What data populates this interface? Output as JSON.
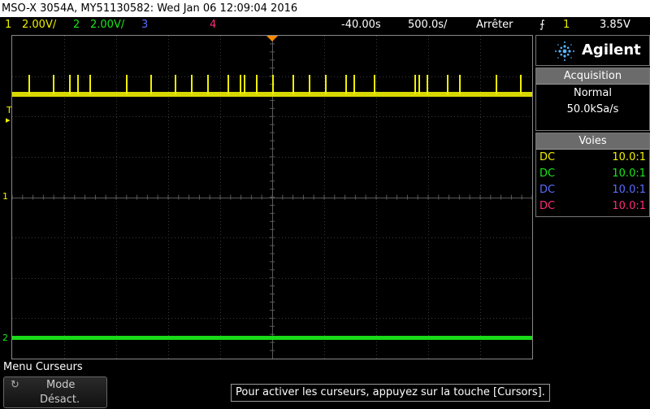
{
  "title": "MSO-X 3054A, MY51130582: Wed Jan 06 12:09:04 2016",
  "status": {
    "ch1_num": "1",
    "ch1_scale": "2.00V/",
    "ch2_num": "2",
    "ch2_scale": "2.00V/",
    "ch3_num": "3",
    "ch4_num": "4",
    "time_offset": "-40.00s",
    "time_scale": "500.0s/",
    "run_state": "Arrêter",
    "trigger_source": "1",
    "trigger_level": "3.85V"
  },
  "markers": {
    "trigger": "T",
    "ch1": "1",
    "ch2": "2"
  },
  "brand": "Agilent",
  "acquisition": {
    "header": "Acquisition",
    "mode": "Normal",
    "rate": "50.0kSa/s"
  },
  "voies": {
    "header": "Voies",
    "rows": [
      {
        "coupling": "DC",
        "probe": "10.0:1"
      },
      {
        "coupling": "DC",
        "probe": "10.0:1"
      },
      {
        "coupling": "DC",
        "probe": "10.0:1"
      },
      {
        "coupling": "DC",
        "probe": "10.0:1"
      }
    ]
  },
  "menu": {
    "title": "Menu Curseurs",
    "softkey_label": "Mode",
    "softkey_value": "Désact."
  },
  "hint": "Pour activer les curseurs, appuyez sur la touche [Cursors].",
  "colors": {
    "ch1": "#f0f000",
    "ch2": "#19e619",
    "ch3": "#5a6cff",
    "ch4": "#ff2a7a"
  }
}
